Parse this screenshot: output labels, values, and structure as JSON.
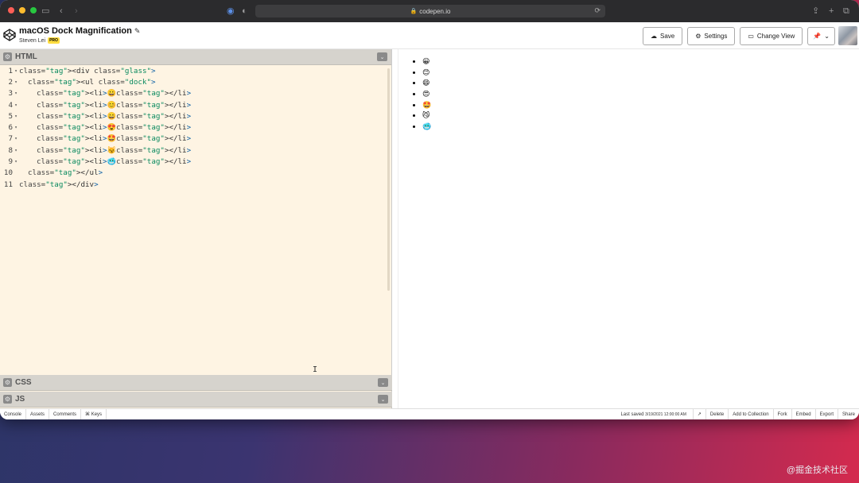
{
  "browser": {
    "address": "codepen.io"
  },
  "pen": {
    "title": "macOS Dock Magnification",
    "author": "Steven Lei",
    "badge": "PRO"
  },
  "header_buttons": {
    "save": "Save",
    "settings": "Settings",
    "change_view": "Change View"
  },
  "panels": {
    "html": "HTML",
    "css": "CSS",
    "js": "JS"
  },
  "code_lines": [
    {
      "n": "1",
      "text": "<div class=\"glass\">"
    },
    {
      "n": "2",
      "text": "<ul class=\"dock\">"
    },
    {
      "n": "3",
      "text": "<li>😀</li>"
    },
    {
      "n": "4",
      "text": "<li>😊</li>"
    },
    {
      "n": "5",
      "text": "<li>😄</li>"
    },
    {
      "n": "6",
      "text": "<li>😍</li>"
    },
    {
      "n": "7",
      "text": "<li>🤩</li>"
    },
    {
      "n": "8",
      "text": "<li>😼</li>"
    },
    {
      "n": "9",
      "text": "<li>🥶</li>"
    },
    {
      "n": "10",
      "text": "</ul>"
    },
    {
      "n": "11",
      "text": "</div>"
    }
  ],
  "preview_items": [
    "😀",
    "😊",
    "😄",
    "😍",
    "🤩",
    "😼",
    "🥶"
  ],
  "footer": {
    "console": "Console",
    "assets": "Assets",
    "comments": "Comments",
    "keys": "⌘ Keys",
    "saved_label": "Last saved",
    "saved_time": "3/19/2021 12:00:00 AM",
    "delete": "Delete",
    "add_to_collection": "Add to Collection",
    "fork": "Fork",
    "embed": "Embed",
    "export": "Export",
    "share": "Share"
  },
  "watermark": "@掘金技术社区",
  "icons": {
    "save": "cloud-icon",
    "settings": "gear-icon",
    "change_view": "layout-icon",
    "pin": "pin-icon"
  }
}
